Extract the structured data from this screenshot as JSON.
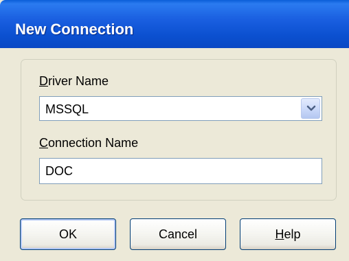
{
  "window": {
    "title": "New Connection"
  },
  "form": {
    "driver_label_accel": "D",
    "driver_label_rest": "river Name",
    "driver_value": "MSSQL",
    "connection_label_accel": "C",
    "connection_label_rest": "onnection Name",
    "connection_value": "DOC"
  },
  "buttons": {
    "ok": "OK",
    "cancel": "Cancel",
    "help_accel": "H",
    "help_rest": "elp"
  },
  "icons": {
    "dropdown": "chevron-down-icon"
  },
  "colors": {
    "titlebar": "#0b50d0",
    "dialog_bg": "#ece9d8",
    "field_border": "#7f9db9",
    "button_border": "#003c74"
  }
}
